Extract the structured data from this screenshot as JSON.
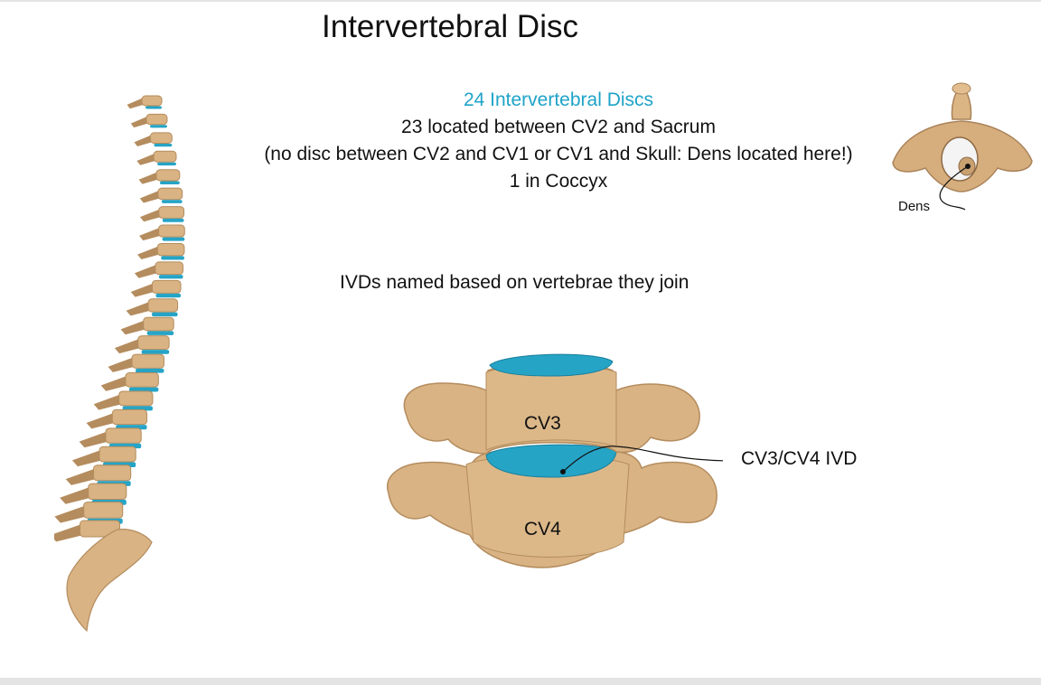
{
  "title": "Intervertebral Disc",
  "info": {
    "highlight": "24 Intervertebral Discs",
    "line2": "23 located between CV2 and Sacrum",
    "line3": "(no disc between CV2 and CV1 or CV1 and Skull: Dens located here!)",
    "line4": "1 in Coccyx"
  },
  "naming_note": "IVDs named based on vertebrae they join",
  "labels": {
    "cv3": "CV3",
    "cv4": "CV4",
    "ivd": "CV3/CV4 IVD",
    "dens": "Dens"
  },
  "colors": {
    "bone": "#d9b383",
    "bone_shadow": "#b48c5e",
    "disc": "#25a4c6",
    "highlight_text": "#1ea3c8"
  },
  "icons": {
    "spine": "spine-illustration",
    "atlas": "atlas-vertebra-illustration",
    "vertebrae": "cervical-vertebrae-illustration"
  }
}
